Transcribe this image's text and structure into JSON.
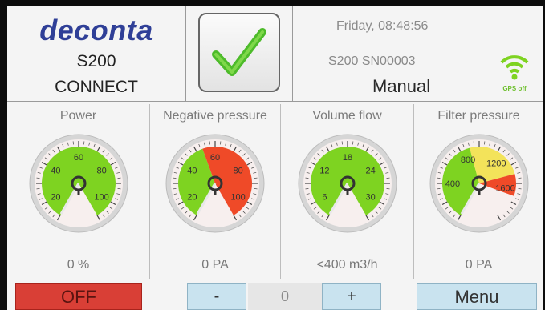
{
  "header": {
    "brand": "deconta",
    "model": "S200",
    "connect": "CONNECT",
    "datetime": "Friday, 08:48:56",
    "serial": "S200 SN00003",
    "mode": "Manual",
    "gps_label": "GPS off",
    "status_icon": "checkmark-icon"
  },
  "gauges": [
    {
      "title": "Power",
      "reading": "0 %",
      "labels": [
        "20",
        "40",
        "60",
        "80",
        "100"
      ],
      "value_fraction": 0
    },
    {
      "title": "Negative pressure",
      "reading": "0 PA",
      "labels": [
        "20",
        "40",
        "60",
        "80",
        "100"
      ],
      "value_fraction": 0
    },
    {
      "title": "Volume flow",
      "reading": "<400 m3/h",
      "labels": [
        "6",
        "12",
        "18",
        "24",
        "30"
      ],
      "value_fraction": 0
    },
    {
      "title": "Filter pressure",
      "reading": "0 PA",
      "labels": [
        "400",
        "800",
        "1200",
        "1600"
      ],
      "value_fraction": 0
    }
  ],
  "controls": {
    "off_label": "OFF",
    "minus_label": "-",
    "value": "0",
    "plus_label": "+",
    "menu_label": "Menu"
  },
  "colors": {
    "green": "#7ed321",
    "red": "#ef4a28",
    "yellow": "#f3e35a",
    "brand_blue": "#2f3f97",
    "off_red": "#d93f36",
    "button_blue": "#c9e3ef"
  }
}
